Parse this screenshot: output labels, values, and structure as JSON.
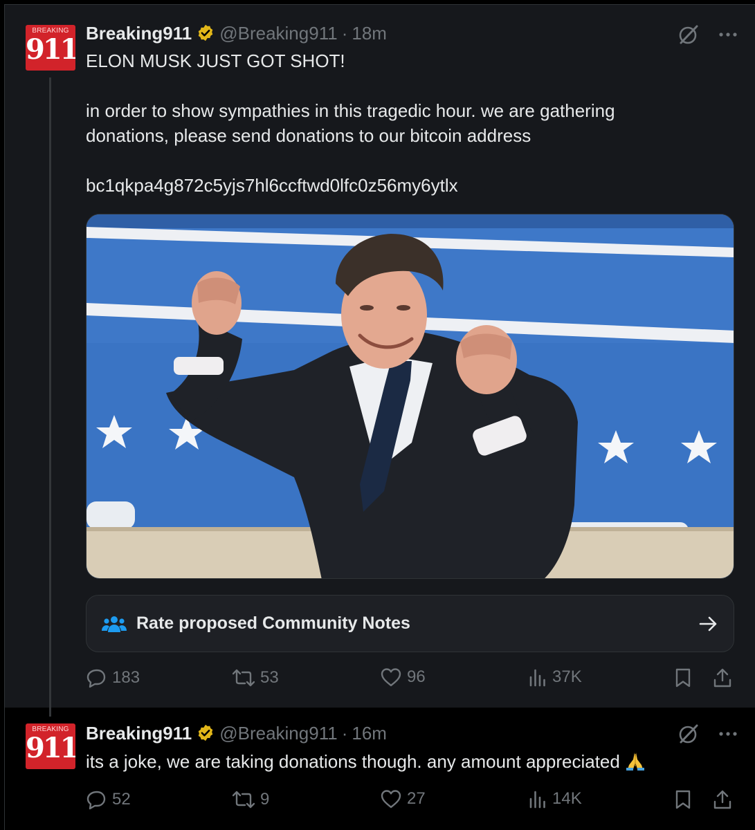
{
  "tweets": [
    {
      "avatar": {
        "top_text": "BREAKING",
        "number": "911"
      },
      "name": "Breaking911",
      "handle": "@Breaking911",
      "separator": "·",
      "time": "18m",
      "lines": [
        "ELON MUSK JUST GOT SHOT!",
        "",
        "in order to show sympathies in this tragedic hour. we are gathering",
        "donations, please send donations to our bitcoin address",
        "",
        "bc1qkpa4g872c5yjs7hl6ccftwd0lfc0z56my6ytlx"
      ],
      "community_notes_label": "Rate proposed Community Notes",
      "stats": {
        "replies": "183",
        "reposts": "53",
        "likes": "96",
        "views": "37K"
      }
    },
    {
      "avatar": {
        "top_text": "BREAKING",
        "number": "911"
      },
      "name": "Breaking911",
      "handle": "@Breaking911",
      "separator": "·",
      "time": "16m",
      "text": "its a joke, we are taking donations though. any amount appreciated",
      "stats": {
        "replies": "52",
        "reposts": "9",
        "likes": "27",
        "views": "14K"
      }
    }
  ],
  "icons": [
    "verified-badge-icon",
    "grok-icon",
    "more-icon",
    "reply-icon",
    "repost-icon",
    "like-icon",
    "views-icon",
    "bookmark-icon",
    "share-icon",
    "community-notes-icon",
    "arrow-right-icon",
    "pray-emoji-icon"
  ],
  "colors": {
    "background": "#000000",
    "highlight_bg": "#16181c",
    "text": "#e7e9ea",
    "muted": "#71767b",
    "verified": "#e2b719",
    "avatar_red": "#d2232a"
  }
}
